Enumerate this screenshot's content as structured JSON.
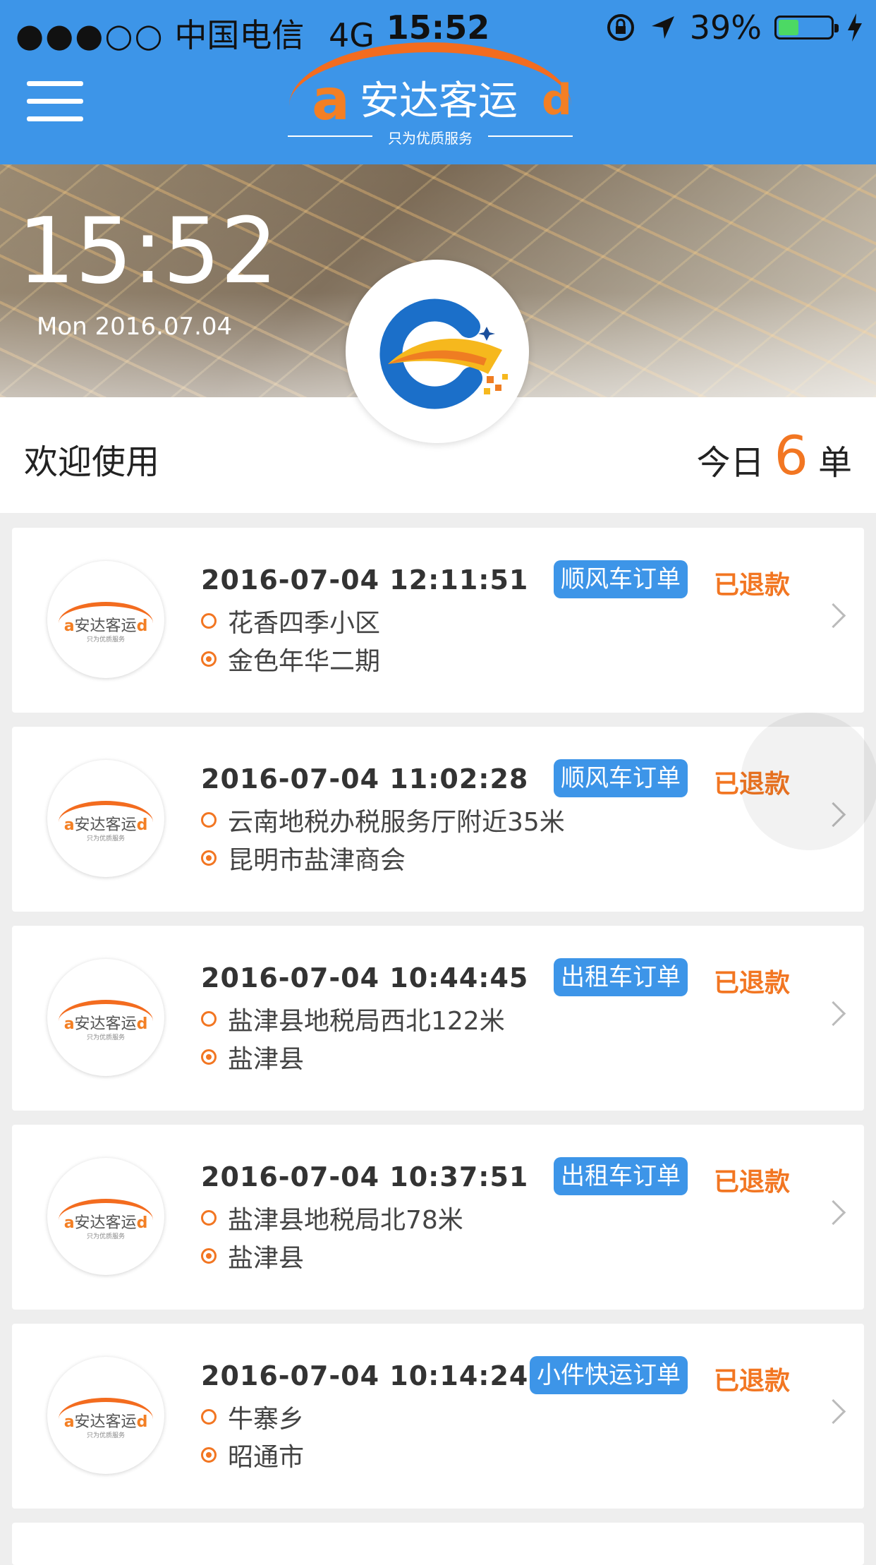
{
  "status_bar": {
    "signal": "●●●○○",
    "carrier": "中国电信",
    "network": "4G",
    "time": "15:52",
    "battery_pct": "39%",
    "battery_level": 0.39
  },
  "header": {
    "brand_a": "a",
    "brand_name": "安达客运",
    "brand_d": "d",
    "slogan": "只为优质服务"
  },
  "hero": {
    "clock": "15:52",
    "date": "Mon 2016.07.04"
  },
  "welcome": {
    "greeting": "欢迎使用",
    "today_label": "今日",
    "today_count": "6",
    "unit": "单"
  },
  "order_avatar": {
    "a": "a",
    "name": "安达客运",
    "d": "d",
    "slogan": "只为优质服务"
  },
  "orders": [
    {
      "datetime": "2016-07-04 12:11:51",
      "type": "顺风车订单",
      "status": "已退款",
      "from": "花香四季小区",
      "to": "金色年华二期"
    },
    {
      "datetime": "2016-07-04 11:02:28",
      "type": "顺风车订单",
      "status": "已退款",
      "from": "云南地税办税服务厅附近35米",
      "to": "昆明市盐津商会"
    },
    {
      "datetime": "2016-07-04 10:44:45",
      "type": "出租车订单",
      "status": "已退款",
      "from": "盐津县地税局西北122米",
      "to": "盐津县"
    },
    {
      "datetime": "2016-07-04 10:37:51",
      "type": "出租车订单",
      "status": "已退款",
      "from": "盐津县地税局北78米",
      "to": "盐津县"
    },
    {
      "datetime": "2016-07-04 10:14:24",
      "type": "小件快运订单",
      "status": "已退款",
      "from": "牛寨乡",
      "to": "昭通市"
    }
  ],
  "colors": {
    "header_blue": "#3d95e8",
    "accent_orange": "#f27622",
    "tag_blue": "#3d95e8"
  }
}
